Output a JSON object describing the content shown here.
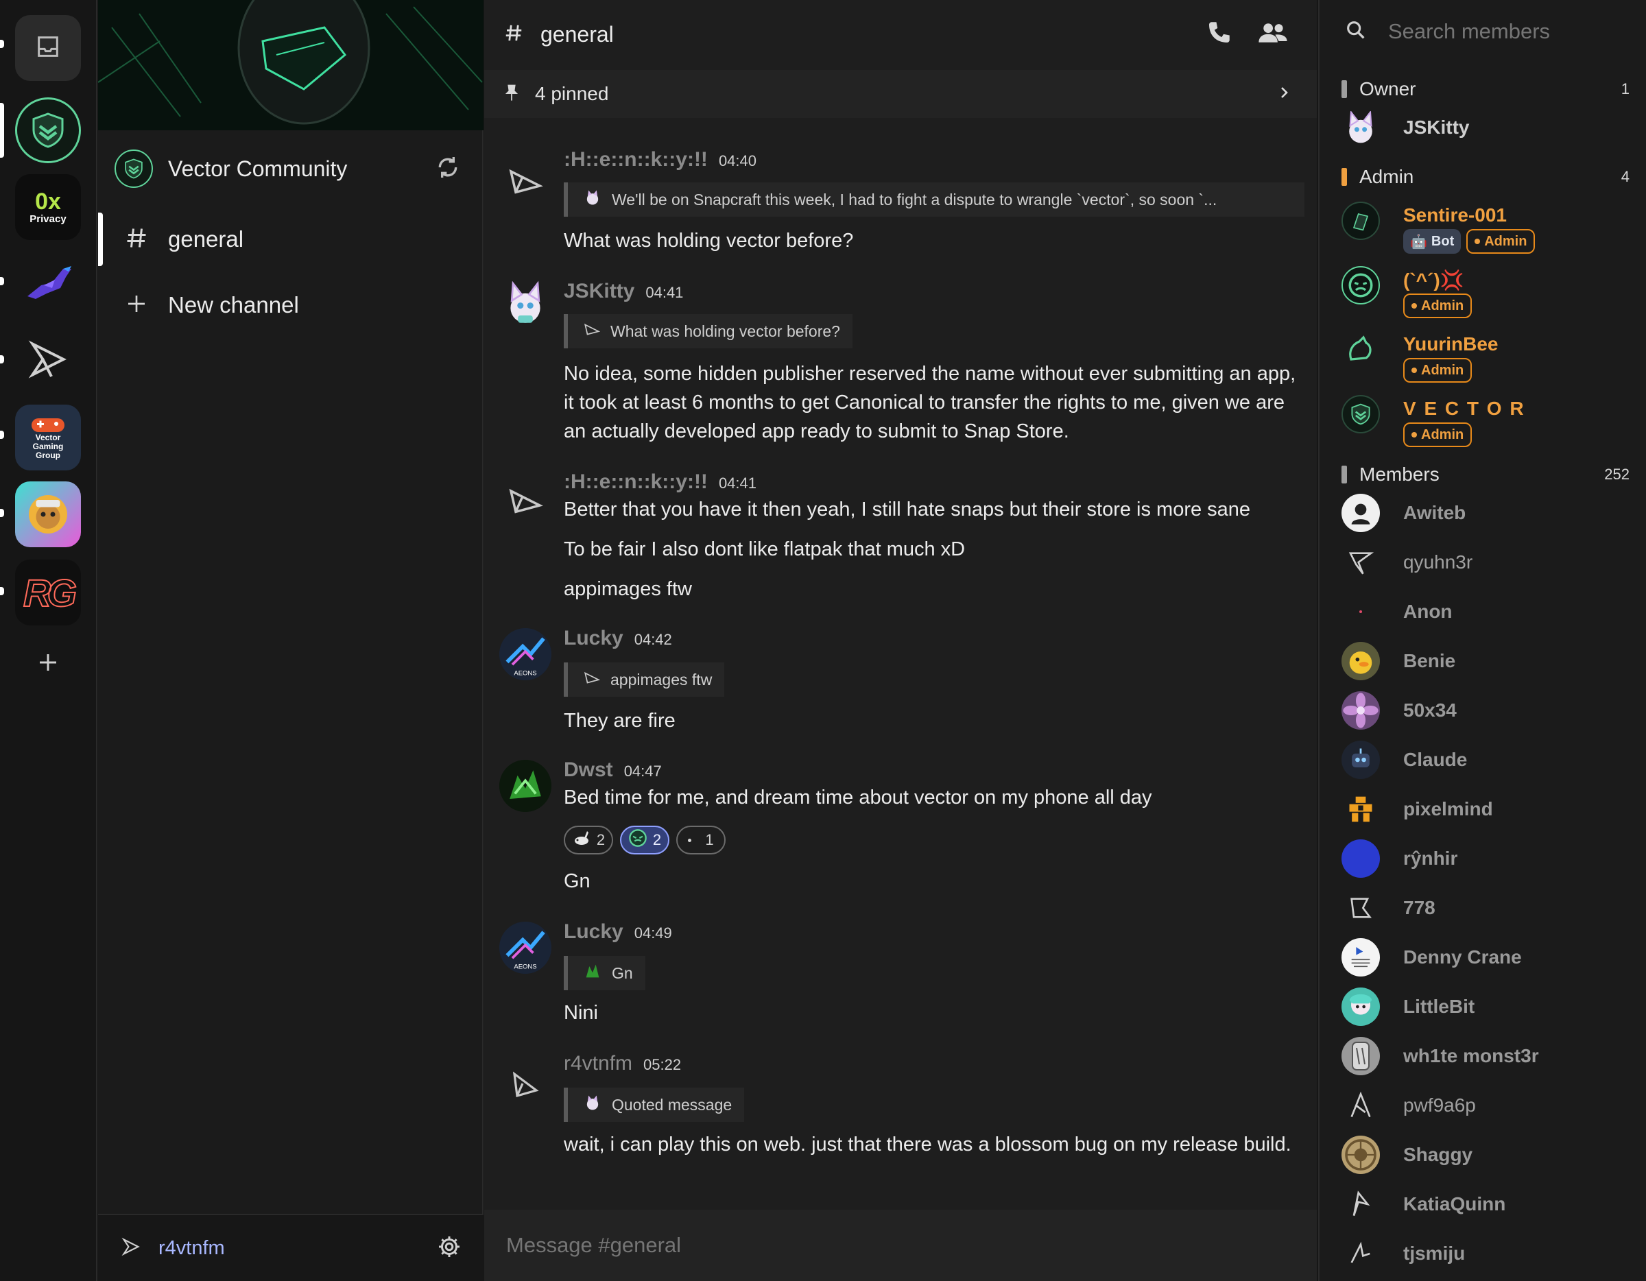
{
  "rail": {
    "servers": [
      {
        "name": "inbox"
      },
      {
        "name": "vector-community",
        "active": true
      },
      {
        "name": "0x-privacy",
        "line1": "0x",
        "line2": "Privacy"
      },
      {
        "name": "pixel-bird"
      },
      {
        "name": "arrow"
      },
      {
        "name": "vector-gaming-group",
        "line1": "Vector",
        "line2": "Gaming",
        "line3": "Group"
      },
      {
        "name": "lion"
      },
      {
        "name": "rg",
        "text": "RG"
      }
    ]
  },
  "community": {
    "name": "Vector Community",
    "channels": [
      {
        "label": "general"
      }
    ],
    "new_channel_label": "New channel"
  },
  "user": {
    "name": "r4vtnfm"
  },
  "chat": {
    "channel_name": "general",
    "pinned_label": "4 pinned",
    "composer_placeholder": "Message #general",
    "messages": [
      {
        "name": ":H::e::n::k::y:!!",
        "time": "04:40",
        "quote": "We'll be on Snapcraft this week, I had to fight a dispute to wrangle `vector`, so soon `...",
        "lines": [
          "What was holding vector before?"
        ]
      },
      {
        "name": "JSKitty",
        "time": "04:41",
        "quote": "What was holding vector before?",
        "lines": [
          "No idea, some hidden publisher reserved the name without ever submitting an app, it took at least 6 months to get Canonical to transfer the rights to me, given we are an actually developed app ready to submit to Snap Store."
        ]
      },
      {
        "name": ":H::e::n::k::y:!!",
        "time": "04:41",
        "lines": [
          "Better that you have it then yeah, I still hate snaps but their store is more sane",
          "To be fair I also dont like flatpak that much xD",
          "appimages ftw"
        ]
      },
      {
        "name": "Lucky",
        "time": "04:42",
        "quote": "appimages ftw",
        "lines": [
          "They are fire"
        ]
      },
      {
        "name": "Dwst",
        "time": "04:47",
        "lines": [
          "Bed time for me,  and dream time about vector on my phone all day",
          "Gn"
        ],
        "reactions": [
          {
            "emoji": "rabbit",
            "count": "2"
          },
          {
            "emoji": "green-face",
            "count": "2"
          },
          {
            "emoji": "dot",
            "count": "1"
          }
        ]
      },
      {
        "name": "Lucky",
        "time": "04:49",
        "quote": "Gn",
        "lines": [
          "Nini"
        ]
      },
      {
        "name": "r4vtnfm",
        "time": "05:22",
        "quote": "Quoted message",
        "lines": [
          "wait, i can play this on web. just that there was a blossom bug on my release build."
        ]
      }
    ]
  },
  "members_panel": {
    "search_placeholder": "Search members",
    "owner": {
      "label": "Owner",
      "count": "1",
      "members": [
        {
          "name": "JSKitty"
        }
      ]
    },
    "admin": {
      "label": "Admin",
      "count": "4",
      "members": [
        {
          "name": "Sentire-001",
          "bot_label": "Bot",
          "role": "Admin"
        },
        {
          "name": "(`^´)💢",
          "role": "Admin"
        },
        {
          "name": "YuurinBee",
          "role": "Admin"
        },
        {
          "name": "V E C T O R",
          "role": "Admin"
        }
      ]
    },
    "members": {
      "label": "Members",
      "count": "252",
      "list": [
        "Awiteb",
        "qyuhn3r",
        "Anon",
        "Benie",
        "50x34",
        "Claude",
        "pixelmind",
        "rŷnhir",
        "778",
        "Denny Crane",
        "LittleBit",
        "wh1te monst3r",
        "pwf9a6p",
        "Shaggy",
        "KatiaQuinn",
        "tjsmiju"
      ]
    }
  },
  "colors": {
    "accent": "#5fd39a",
    "admin": "#f0a040",
    "owner_bar": "#9e9e9e",
    "bot_badge": "#3a4252"
  }
}
